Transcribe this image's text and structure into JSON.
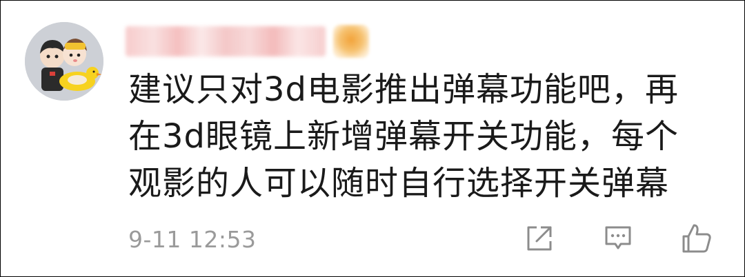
{
  "comment": {
    "username": "",
    "content": "建议只对3d电影推出弹幕功能吧，再在3d眼镜上新增弹幕开关功能，每个观影的人可以随时自行选择开关弹幕",
    "timestamp": "9-11 12:53"
  },
  "actions": {
    "share_icon": "share-icon",
    "reply_icon": "comment-icon",
    "like_icon": "thumbs-up-icon"
  },
  "colors": {
    "text": "#1a1a1a",
    "meta": "#9a9a9a",
    "icon": "#8c8c8c"
  }
}
